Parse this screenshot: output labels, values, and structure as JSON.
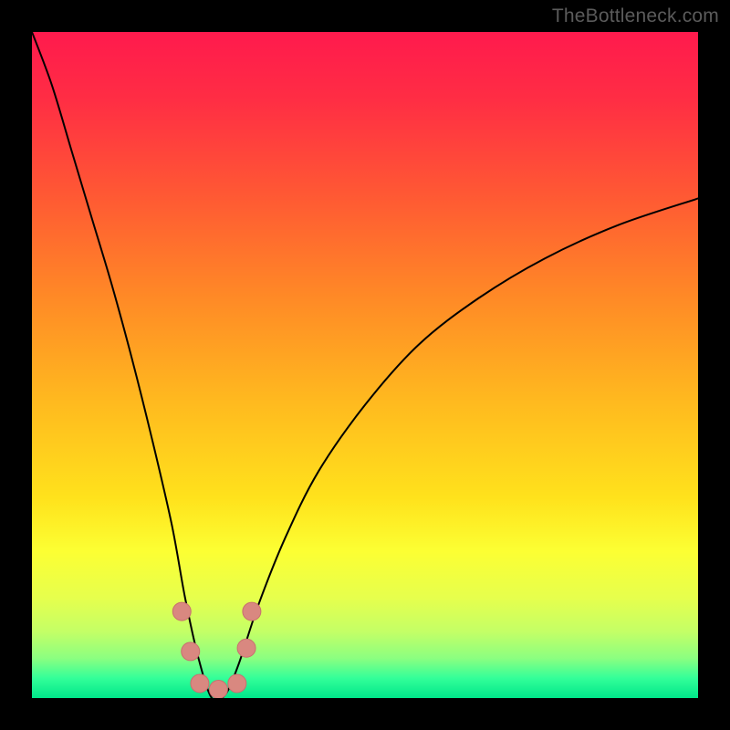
{
  "watermark": "TheBottleneck.com",
  "colors": {
    "gradient_stops": [
      {
        "offset": 0.0,
        "color": "#ff1a4d"
      },
      {
        "offset": 0.1,
        "color": "#ff2d44"
      },
      {
        "offset": 0.25,
        "color": "#ff5a33"
      },
      {
        "offset": 0.4,
        "color": "#ff8a26"
      },
      {
        "offset": 0.55,
        "color": "#ffb81f"
      },
      {
        "offset": 0.7,
        "color": "#ffe21c"
      },
      {
        "offset": 0.78,
        "color": "#fcff33"
      },
      {
        "offset": 0.85,
        "color": "#e6ff4d"
      },
      {
        "offset": 0.9,
        "color": "#c4ff66"
      },
      {
        "offset": 0.94,
        "color": "#8cff80"
      },
      {
        "offset": 0.97,
        "color": "#33ff99"
      },
      {
        "offset": 1.0,
        "color": "#00e68a"
      }
    ],
    "curve": "#000000",
    "marker_fill": "#d98880",
    "marker_stroke": "#c96f6f"
  },
  "chart_data": {
    "type": "line",
    "title": "",
    "xlabel": "",
    "ylabel": "",
    "xlim": [
      0,
      100
    ],
    "ylim": [
      0,
      100
    ],
    "grid": false,
    "curve": {
      "name": "bottleneck-curve",
      "min_x": 27,
      "points": [
        {
          "x": 0,
          "y": 100
        },
        {
          "x": 3,
          "y": 92
        },
        {
          "x": 6,
          "y": 82
        },
        {
          "x": 9,
          "y": 72
        },
        {
          "x": 12,
          "y": 62
        },
        {
          "x": 15,
          "y": 51
        },
        {
          "x": 18,
          "y": 39
        },
        {
          "x": 21,
          "y": 26
        },
        {
          "x": 23,
          "y": 15
        },
        {
          "x": 25,
          "y": 6
        },
        {
          "x": 27,
          "y": 0
        },
        {
          "x": 29,
          "y": 0.5
        },
        {
          "x": 31,
          "y": 5
        },
        {
          "x": 34,
          "y": 14
        },
        {
          "x": 38,
          "y": 24
        },
        {
          "x": 43,
          "y": 34
        },
        {
          "x": 50,
          "y": 44
        },
        {
          "x": 58,
          "y": 53
        },
        {
          "x": 67,
          "y": 60
        },
        {
          "x": 77,
          "y": 66
        },
        {
          "x": 88,
          "y": 71
        },
        {
          "x": 100,
          "y": 75
        }
      ]
    },
    "markers": [
      {
        "x": 22.5,
        "y": 13,
        "r": 10
      },
      {
        "x": 23.8,
        "y": 7,
        "r": 10
      },
      {
        "x": 25.2,
        "y": 2.2,
        "r": 10
      },
      {
        "x": 28.0,
        "y": 1.3,
        "r": 10
      },
      {
        "x": 30.8,
        "y": 2.2,
        "r": 10
      },
      {
        "x": 32.2,
        "y": 7.5,
        "r": 10
      },
      {
        "x": 33.0,
        "y": 13,
        "r": 10
      }
    ]
  }
}
